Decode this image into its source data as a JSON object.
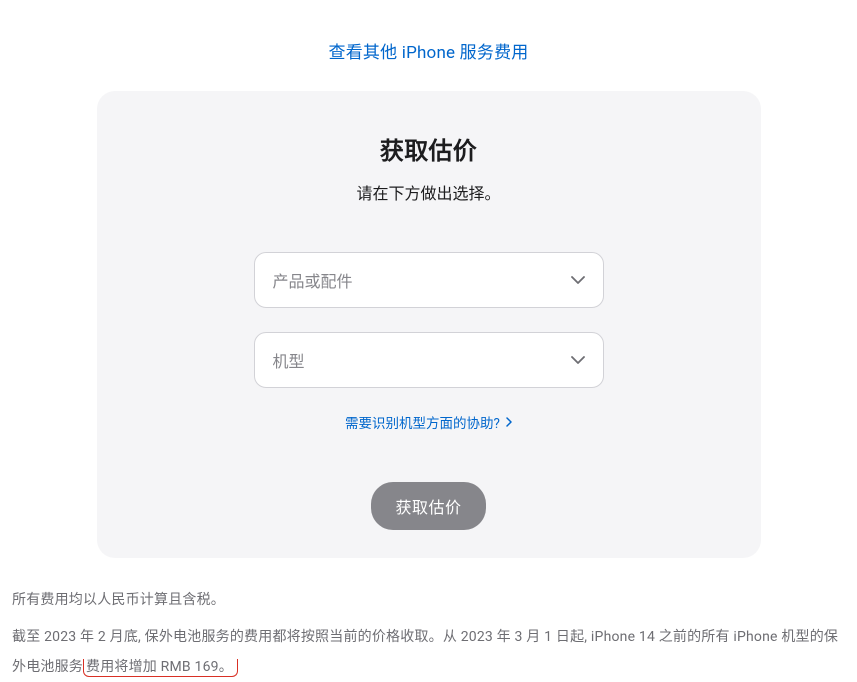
{
  "topLink": {
    "label": "查看其他 iPhone 服务费用"
  },
  "card": {
    "title": "获取估价",
    "subtitle": "请在下方做出选择。",
    "select1": {
      "placeholder": "产品或配件"
    },
    "select2": {
      "placeholder": "机型"
    },
    "helpLink": {
      "label": "需要识别机型方面的协助?"
    },
    "cta": {
      "label": "获取估价"
    }
  },
  "footer": {
    "line1": "所有费用均以人民币计算且含税。",
    "line2_part1": "截至 2023 年 2 月底, 保外电池服务的费用都将按照当前的价格收取。从 2023 年 3 月 1 日起, iPhone 14 之前的所有 iPhone 机型的保外电池服务",
    "line2_highlight": "费用将增加 RMB 169。"
  }
}
